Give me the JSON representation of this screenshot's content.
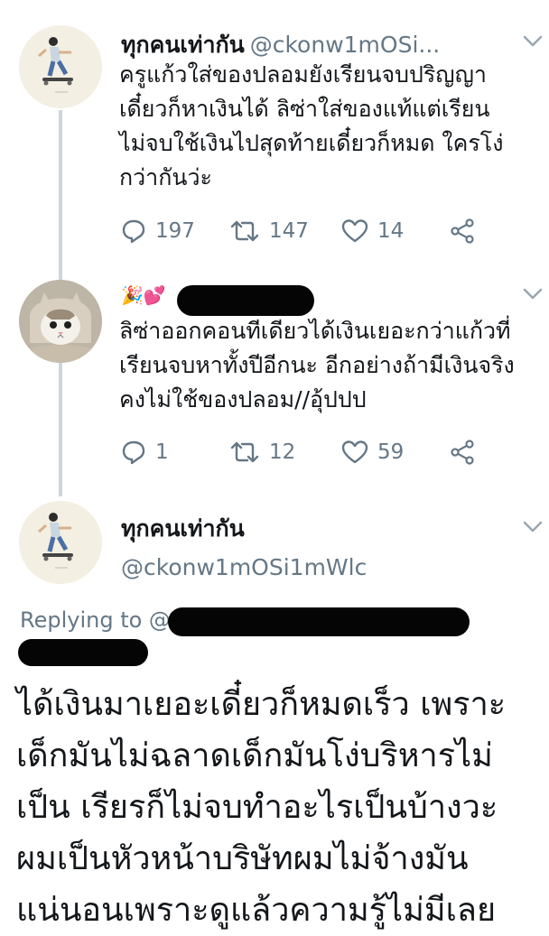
{
  "tweets": [
    {
      "display_name": "ทุกคนเท่ากัน",
      "handle": "@ckonw1mOSi...",
      "text_lines": [
        "ครูแก้วใส่ของปลอมยังเรียนจบปริญญา",
        "เดี๋ยวก็หาเงินได้ ลิซ่าใส่ของแท้แต่เรียน",
        "ไม่จบใช้เงินไปสุดท้ายเดี๋ยวก็หมด ใครโง่",
        "กว่ากันว่ะ"
      ],
      "replies": "197",
      "retweets": "147",
      "likes": "14"
    },
    {
      "display_name_emoji": "🎉💕",
      "text_lines": [
        "ลิซ่าออกคอนทีเดียวได้เงินเยอะกว่าแก้วที่",
        "เรียนจบหาทั้งปีอีกนะ อีกอย่างถ้ามีเงินจริง",
        "คงไม่ใช้ของปลอม//อุ้ปปป"
      ],
      "replies": "1",
      "retweets": "12",
      "likes": "59"
    }
  ],
  "focused": {
    "display_name": "ทุกคนเท่ากัน",
    "handle": "@ckonw1mOSi1mWlc",
    "replying_to": "Replying to @",
    "text_lines": [
      "ได้เงินมาเยอะเดี๋ยวก็หมดเร็ว เพราะ",
      "เด็กมันไม่ฉลาดเด็กมันโง่บริหารไม่",
      "เป็น เรียรก็ไม่จบทำอะไรเป็นบ้างวะ",
      "ผมเป็นหัวหน้าบริษัทผมไม่จ้างมัน",
      "แน่นอนเพราะดูแล้วความรู้ไม่มีเลย"
    ]
  },
  "icons": {
    "reply": "reply-icon",
    "retweet": "retweet-icon",
    "like": "heart-icon",
    "share": "share-icon",
    "menu": "chevron-down-icon"
  },
  "colors": {
    "text": "#14171a",
    "secondary": "#657786",
    "thread_line": "#ccd6dd",
    "background": "#ffffff"
  }
}
